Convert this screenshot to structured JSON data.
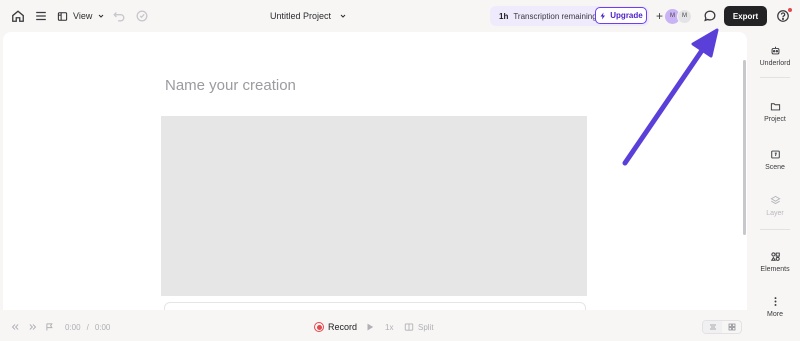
{
  "toolbar": {
    "view_label": "View",
    "project_title": "Untitled Project",
    "transcription_hours": "1h",
    "transcription_text": "Transcription remaining",
    "upgrade_label": "Upgrade",
    "avatar_1_initial": "M",
    "avatar_2_initial": "M",
    "export_label": "Export"
  },
  "canvas": {
    "creation_placeholder": "Name your creation"
  },
  "sidebar": {
    "items": [
      {
        "label": "Underlord",
        "icon": "robot-icon",
        "enabled": true
      },
      {
        "label": "Project",
        "icon": "folder-icon",
        "enabled": true
      },
      {
        "label": "Scene",
        "icon": "scene-icon",
        "enabled": true
      },
      {
        "label": "Layer",
        "icon": "layers-icon",
        "enabled": false
      },
      {
        "label": "Elements",
        "icon": "elements-icon",
        "enabled": true
      },
      {
        "label": "More",
        "icon": "more-vertical-icon",
        "enabled": true
      }
    ]
  },
  "playback": {
    "current_time": "0:00",
    "separator": "/",
    "total_time": "0:00",
    "record_label": "Record",
    "speed_label": "1x",
    "split_label": "Split"
  },
  "colors": {
    "accent_purple": "#6d3ff0",
    "annotation_arrow": "#5b3fd9",
    "record_red": "#e5484d",
    "export_bg": "#232325"
  }
}
